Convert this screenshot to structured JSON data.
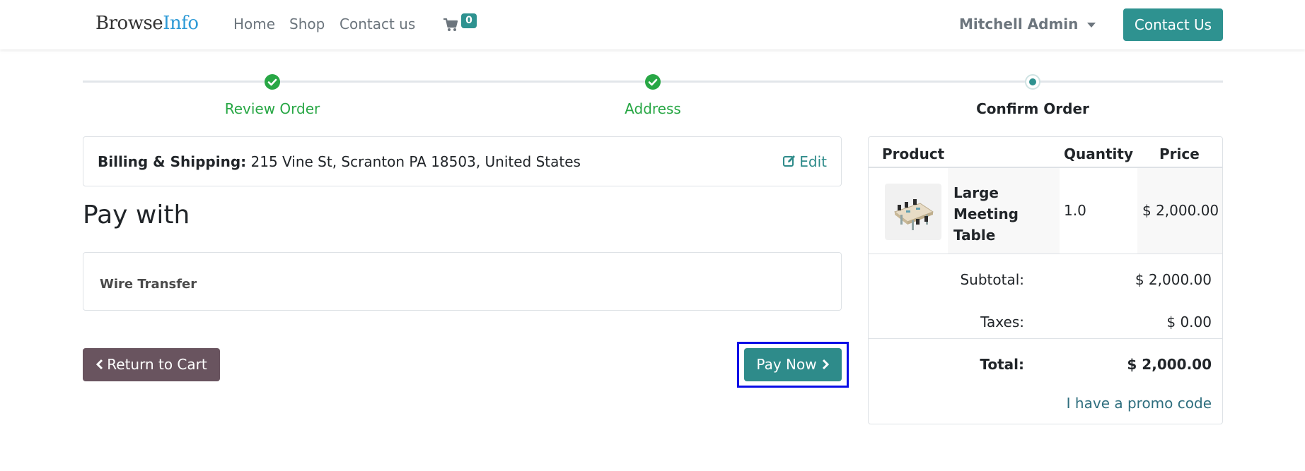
{
  "header": {
    "brand_part1": "Browse",
    "brand_part2": "Info",
    "nav": [
      "Home",
      "Shop",
      "Contact us"
    ],
    "cart_count": "0",
    "user_name": "Mitchell Admin",
    "contact_button": "Contact Us"
  },
  "steps": [
    {
      "label": "Review Order",
      "state": "done"
    },
    {
      "label": "Address",
      "state": "done"
    },
    {
      "label": "Confirm Order",
      "state": "current"
    }
  ],
  "billing": {
    "label": "Billing & Shipping:",
    "address": "215 Vine St, Scranton PA 18503, United States",
    "edit_label": "Edit"
  },
  "pay_with_title": "Pay with",
  "payment_method": "Wire Transfer",
  "buttons": {
    "return_label": "Return to Cart",
    "pay_now_label": "Pay Now"
  },
  "summary": {
    "headers": {
      "product": "Product",
      "quantity": "Quantity",
      "price": "Price"
    },
    "item": {
      "name": "Large Meeting Table",
      "quantity": "1.0",
      "price": "$ 2,000.00"
    },
    "subtotal_label": "Subtotal:",
    "subtotal_value": "$ 2,000.00",
    "taxes_label": "Taxes:",
    "taxes_value": "$ 0.00",
    "total_label": "Total:",
    "total_value": "$ 2,000.00",
    "promo_label": "I have a promo code"
  },
  "colors": {
    "accent": "#2e9290",
    "success": "#28a745",
    "return_button": "#69545f",
    "highlight_frame": "#0a0ee6",
    "corner_ribbon": "#6d5068"
  }
}
